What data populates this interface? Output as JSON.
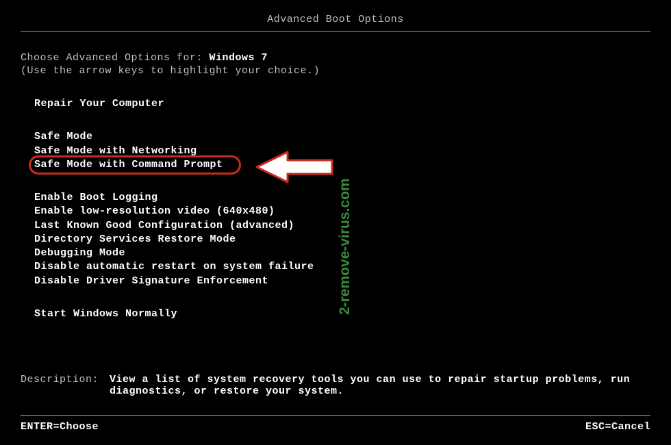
{
  "title": "Advanced Boot Options",
  "prompt": {
    "label": "Choose Advanced Options for: ",
    "os": "Windows 7"
  },
  "hint": "(Use the arrow keys to highlight your choice.)",
  "menu": {
    "repair": "Repair Your Computer",
    "safe_mode": "Safe Mode",
    "safe_mode_net": "Safe Mode with Networking",
    "safe_mode_cmd": "Safe Mode with Command Prompt",
    "boot_logging": "Enable Boot Logging",
    "low_res": "Enable low-resolution video (640x480)",
    "lkgc": "Last Known Good Configuration (advanced)",
    "dsrm": "Directory Services Restore Mode",
    "debug": "Debugging Mode",
    "no_auto_restart": "Disable automatic restart on system failure",
    "no_sig_enforce": "Disable Driver Signature Enforcement",
    "start_normal": "Start Windows Normally"
  },
  "description": {
    "label": "Description:",
    "text": "View a list of system recovery tools you can use to repair startup problems, run diagnostics, or restore your system."
  },
  "footer": {
    "enter": "ENTER=Choose",
    "esc": "ESC=Cancel"
  },
  "watermark": "2-remove-virus.com",
  "annotation": {
    "highlight_color": "#cc2a1a",
    "arrow_color": "#ffffff"
  }
}
